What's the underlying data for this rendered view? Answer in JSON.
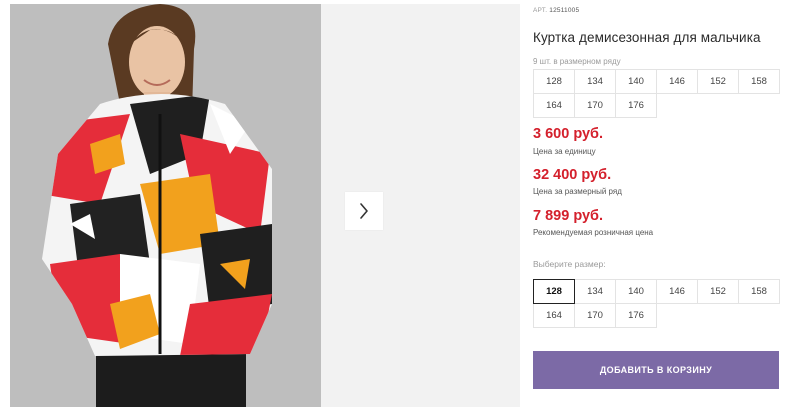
{
  "gallery": {
    "next_icon": "chevron-right-icon",
    "photo_alt": "Куртка демисезонная для мальчика"
  },
  "product": {
    "sku_label": "АРТ.",
    "sku_value": "12511005",
    "title": "Куртка демисезонная для мальчика",
    "pack_note": "9 шт. в размерном ряду",
    "pack_sizes": [
      "128",
      "134",
      "140",
      "146",
      "152",
      "158",
      "164",
      "170",
      "176"
    ]
  },
  "prices": [
    {
      "amount": "3 600 руб.",
      "caption": "Цена за единицу"
    },
    {
      "amount": "32 400 руб.",
      "caption": "Цена за размерный ряд"
    },
    {
      "amount": "7 899 руб.",
      "caption": "Рекомендуемая розничная цена"
    }
  ],
  "size_picker": {
    "label": "Выберите размер:",
    "sizes": [
      "128",
      "134",
      "140",
      "146",
      "152",
      "158",
      "164",
      "170",
      "176"
    ],
    "selected": "128"
  },
  "cart": {
    "button_label": "ДОБАВИТЬ В КОРЗИНУ"
  },
  "colors": {
    "price": "#d4202c",
    "cart_button": "#7c6aa6",
    "gallery_bg": "#f2f2f2"
  }
}
